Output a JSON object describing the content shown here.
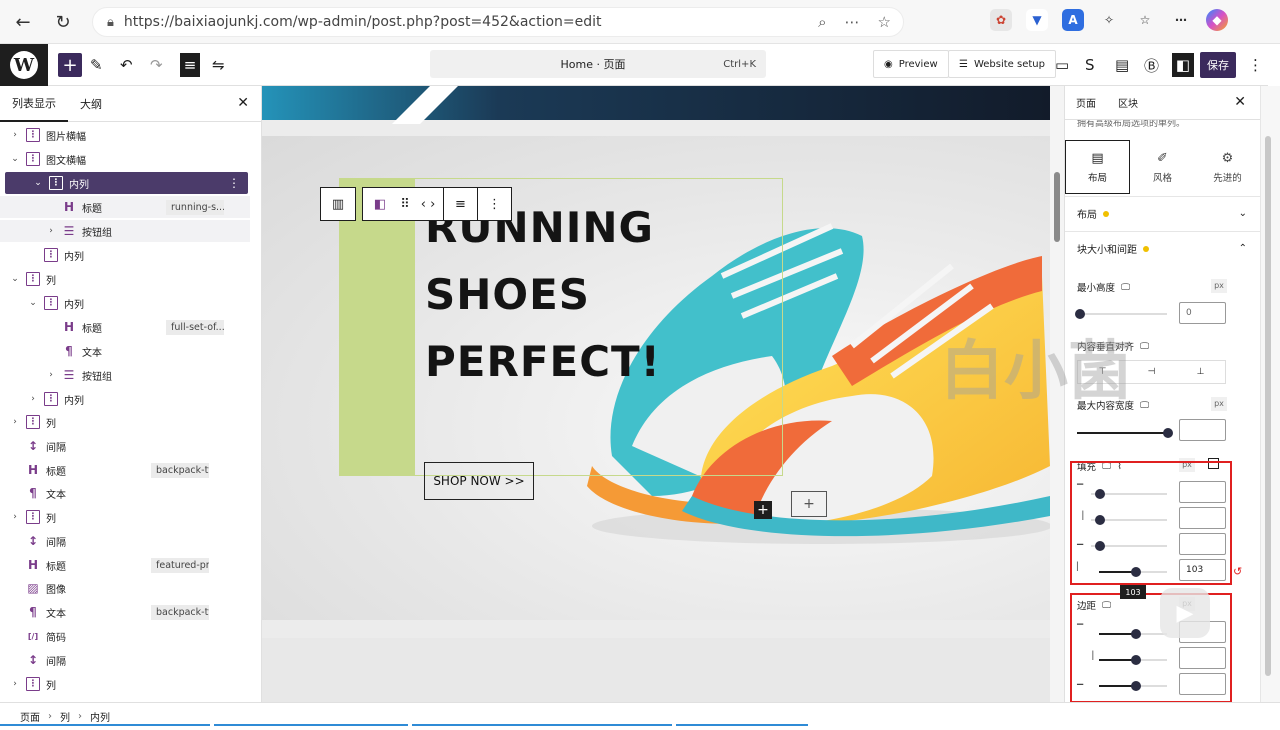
{
  "browser": {
    "url": "https://baixiaojunkj.com/wp-admin/post.php?post=452&action=edit"
  },
  "toolbar": {
    "command_title": "Home · 页面",
    "command_shortcut": "Ctrl+K",
    "preview_label": "Preview",
    "website_setup_label": "Website setup",
    "save_label": "保存"
  },
  "list_view": {
    "tab_list": "列表显示",
    "tab_outline": "大纲",
    "rows": [
      {
        "label": "图片横幅",
        "tag": ""
      },
      {
        "label": "图文横幅",
        "tag": ""
      },
      {
        "label": "内列",
        "tag": ""
      },
      {
        "label": "标题",
        "tag": "running-s..."
      },
      {
        "label": "按钮组",
        "tag": ""
      },
      {
        "label": "内列",
        "tag": ""
      },
      {
        "label": "列",
        "tag": ""
      },
      {
        "label": "内列",
        "tag": ""
      },
      {
        "label": "标题",
        "tag": "full-set-of..."
      },
      {
        "label": "文本",
        "tag": ""
      },
      {
        "label": "按钮组",
        "tag": ""
      },
      {
        "label": "内列",
        "tag": ""
      },
      {
        "label": "列",
        "tag": ""
      },
      {
        "label": "间隔",
        "tag": ""
      },
      {
        "label": "标题",
        "tag": "backpack-ty..."
      },
      {
        "label": "文本",
        "tag": ""
      },
      {
        "label": "列",
        "tag": ""
      },
      {
        "label": "间隔",
        "tag": ""
      },
      {
        "label": "标题",
        "tag": "featured-pro..."
      },
      {
        "label": "图像",
        "tag": ""
      },
      {
        "label": "文本",
        "tag": "backpack-ty..."
      },
      {
        "label": "简码",
        "tag": ""
      },
      {
        "label": "间隔",
        "tag": ""
      },
      {
        "label": "列",
        "tag": ""
      }
    ]
  },
  "canvas": {
    "headline_line1": "RUNNING",
    "headline_line2": "SHOES",
    "headline_line3": "PERFECT!",
    "button_label": "SHOP NOW >>"
  },
  "settings": {
    "tab_page": "页面",
    "tab_block": "区块",
    "note": "拥有高级布局选项的单列。",
    "subtab_layout": "布局",
    "subtab_style": "风格",
    "subtab_advanced": "先进的",
    "section_layout": "布局",
    "section_size": "块大小和间距",
    "min_height_label": "最小高度",
    "min_height_value": "0",
    "unit_px": "px",
    "valign_label": "内容垂直对齐",
    "max_width_label": "最大内容宽度",
    "padding_label": "填充",
    "padding_value_left": "103",
    "tooltip_value": "103",
    "margin_label": "边距"
  },
  "watermark": {
    "text": "白小菌"
  },
  "footer": {
    "crumb1": "页面",
    "crumb2": "列",
    "crumb3": "内列"
  },
  "colors": {
    "accent": "#3b2a5c",
    "green_bar": "#c6d98b",
    "highlight_red": "#e02020",
    "dot_yellow": "#f0c000"
  }
}
